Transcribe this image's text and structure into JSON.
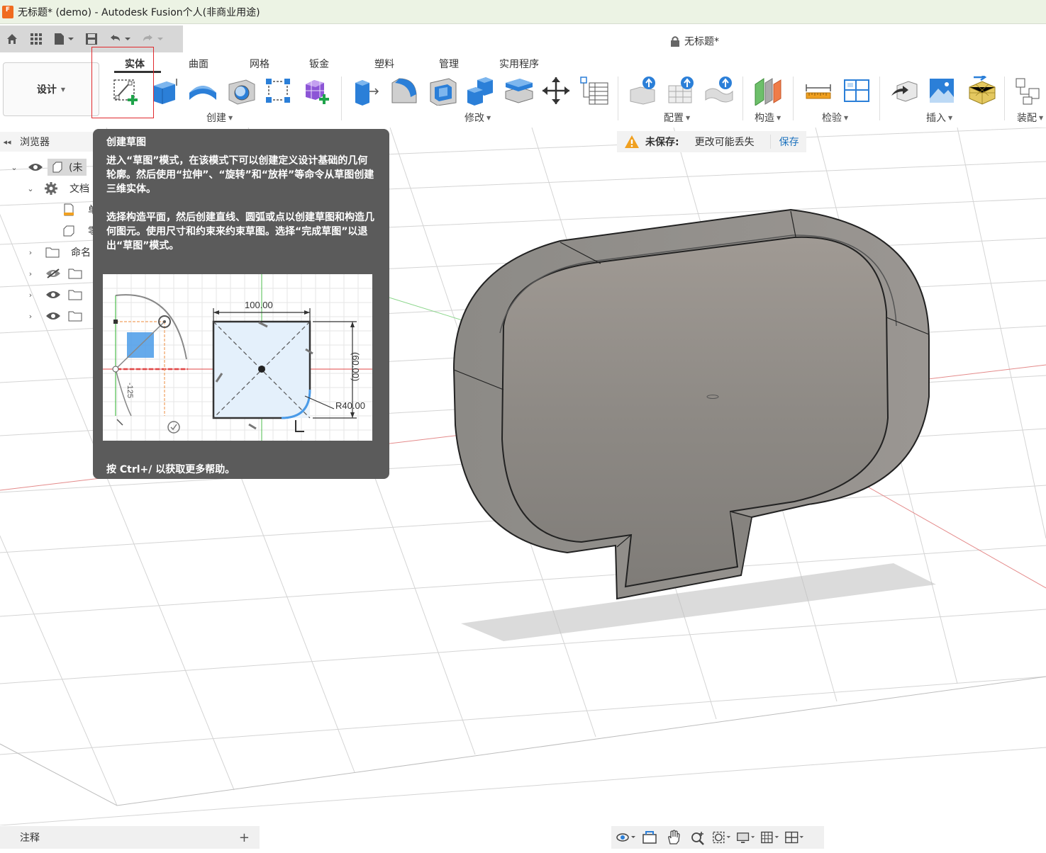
{
  "window": {
    "title": "无标题* (demo) - Autodesk Fusion个人(非商业用途)",
    "doc_title": "无标题*"
  },
  "workspace": {
    "label": "设计"
  },
  "tabs": [
    {
      "label": "实体",
      "active": true
    },
    {
      "label": "曲面"
    },
    {
      "label": "网格"
    },
    {
      "label": "钣金"
    },
    {
      "label": "塑料"
    },
    {
      "label": "管理"
    },
    {
      "label": "实用程序"
    }
  ],
  "groups": {
    "create": "创建",
    "modify": "修改",
    "configure": "配置",
    "construct": "构造",
    "inspect": "检验",
    "insert": "插入",
    "assemble": "装配"
  },
  "browser": {
    "title": "浏览器",
    "root_label": "(未",
    "doc_settings": "文档",
    "item_units": "单",
    "item_origin": "零",
    "named_views": "命名"
  },
  "unsaved": {
    "label": "未保存:",
    "message": "更改可能丢失",
    "save_link": "保存"
  },
  "tooltip": {
    "title": "创建草图",
    "para1": "进入“草图”模式，在该模式下可以创建定义设计基础的几何轮廓。然后使用“拉伸”、“旋转”和“放样”等命令从草图创建三维实体。",
    "para2": "选择构造平面，然后创建直线、圆弧或点以创建草图和构造几何图元。使用尺寸和约束来约束草图。选择“完成草图”以退出“草图”模式。",
    "footer": "按 Ctrl+/ 以获取更多帮助。",
    "dim_width": "100.00",
    "dim_height": "(60.00)",
    "dim_radius": "R40.00",
    "dim_angle": "-125"
  },
  "annotations": {
    "label": "注释",
    "add": "+"
  },
  "colors": {
    "accent": "#1e73be",
    "highlight": "#e0292d",
    "tooltip_bg": "#5b5b5b"
  }
}
